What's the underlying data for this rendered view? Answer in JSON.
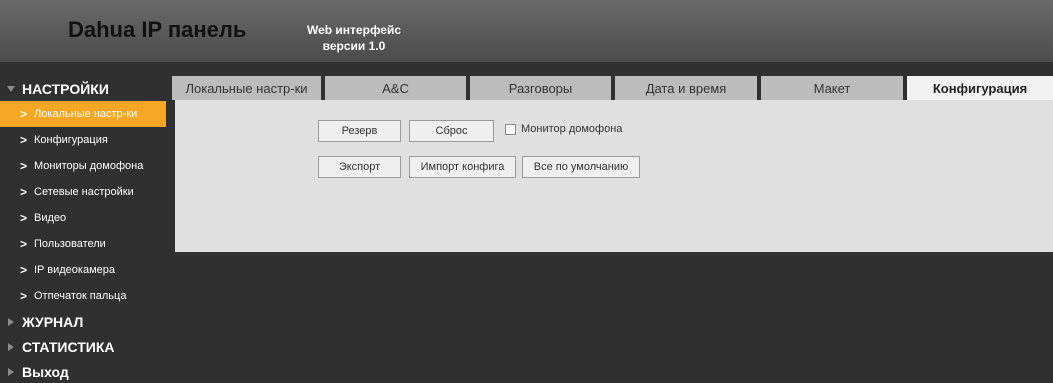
{
  "header": {
    "logo": "Dahua IP панель",
    "sub_line1": "Web интерфейс",
    "sub_line2": "версии 1.0"
  },
  "sidebar": {
    "settings_label": "НАСТРОЙКИ",
    "items": [
      {
        "label": "Локальные настр-ки",
        "active": true
      },
      {
        "label": "Конфигурация"
      },
      {
        "label": "Мониторы домофона"
      },
      {
        "label": "Сетевые настройки"
      },
      {
        "label": "Видео"
      },
      {
        "label": "Пользователи"
      },
      {
        "label": "IP видеокамера"
      },
      {
        "label": "Отпечаток пальца"
      }
    ],
    "journal_label": "ЖУРНАЛ",
    "stats_label": "СТАТИСТИКА",
    "exit_label": "Выход"
  },
  "tabs": [
    {
      "label": "Локальные настр-ки"
    },
    {
      "label": "A&C"
    },
    {
      "label": "Разговоры"
    },
    {
      "label": "Дата и время"
    },
    {
      "label": "Макет"
    },
    {
      "label": "Конфигурация",
      "active": true
    }
  ],
  "content": {
    "backup_label": "Резерв",
    "reset_label": "Сброс",
    "monitor_label": "Монитор домофона",
    "export_label": "Экспорт",
    "import_label": "Импорт конфига",
    "defaults_label": "Все по умолчанию"
  },
  "colors": {
    "accent": "#f5a623",
    "background": "#303030",
    "content_bg": "#e0e0e0"
  }
}
